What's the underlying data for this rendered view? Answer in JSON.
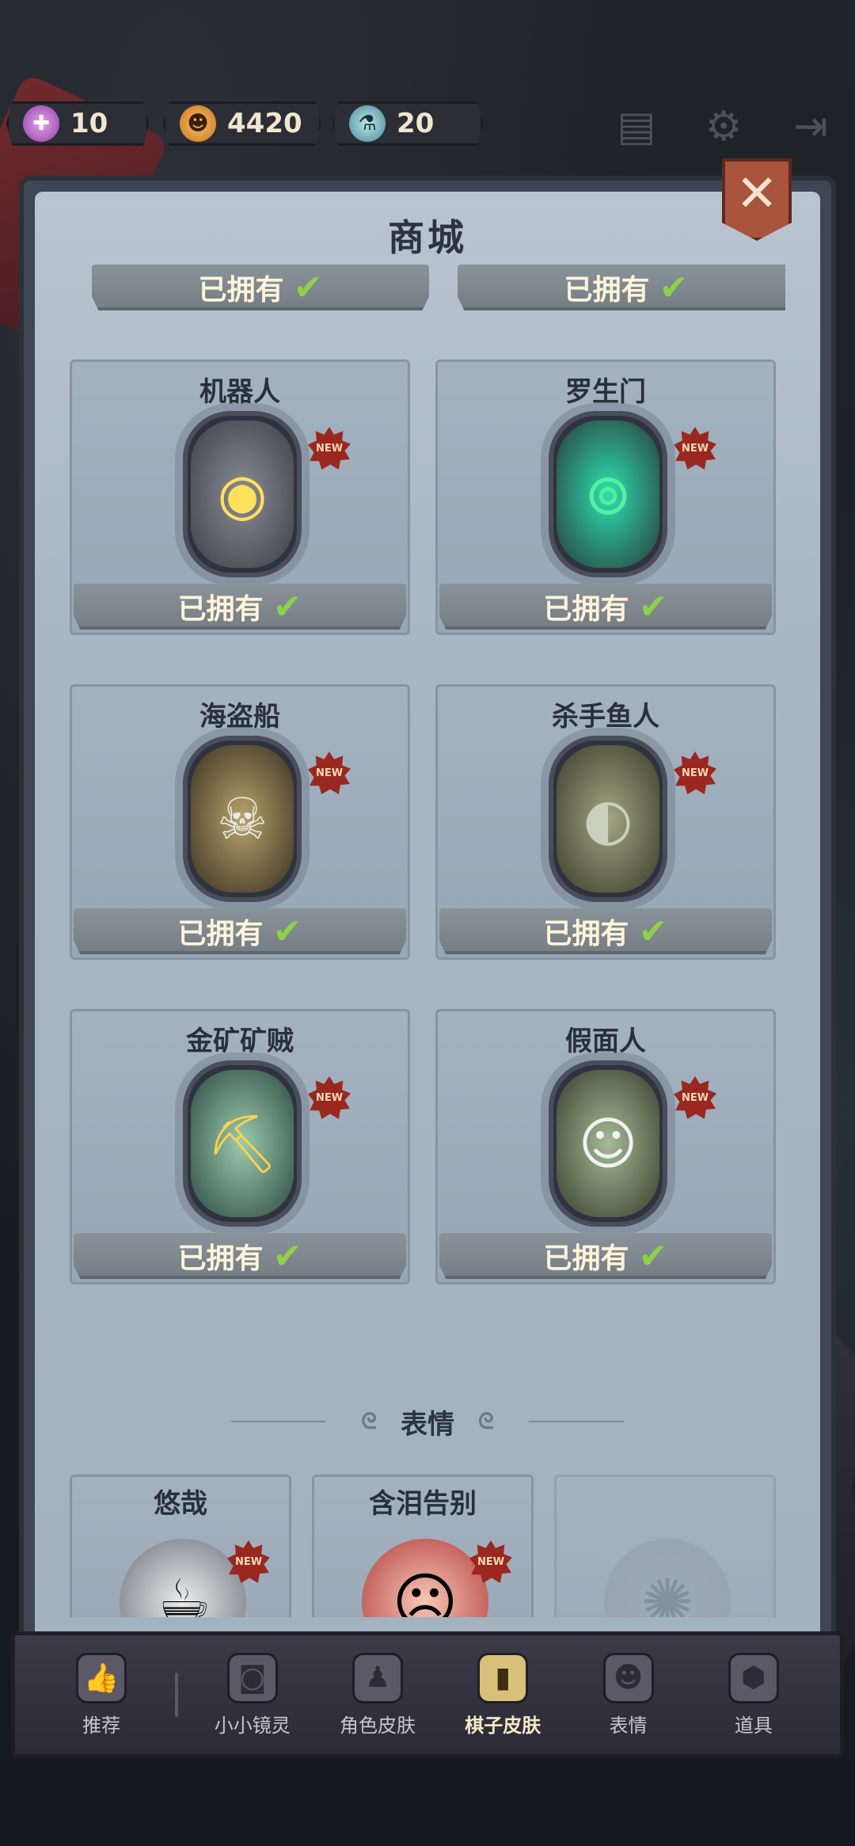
{
  "resources": {
    "candy": {
      "value": "10",
      "icon": "candy-icon"
    },
    "pumpkin": {
      "value": "4420",
      "icon": "pumpkin-icon"
    },
    "potion": {
      "value": "20",
      "icon": "potion-icon"
    }
  },
  "top_icons": [
    "book-icon",
    "gear-icon",
    "exit-icon"
  ],
  "shop": {
    "title": "商城",
    "owned_label": "已拥有",
    "items": [
      {
        "name": "机器人",
        "badge": "NEW"
      },
      {
        "name": "罗生门",
        "badge": "NEW"
      },
      {
        "name": "海盗船",
        "badge": "NEW"
      },
      {
        "name": "杀手鱼人",
        "badge": "NEW"
      },
      {
        "name": "金矿矿贼",
        "badge": "NEW"
      },
      {
        "name": "假面人",
        "badge": "NEW"
      }
    ],
    "emote_section": "表情",
    "emotes": [
      {
        "name": "悠哉",
        "badge": "NEW"
      },
      {
        "name": "含泪告别",
        "badge": "NEW"
      }
    ]
  },
  "nav": [
    {
      "label": "推荐"
    },
    {
      "label": "小小镜灵"
    },
    {
      "label": "角色皮肤"
    },
    {
      "label": "棋子皮肤"
    },
    {
      "label": "表情"
    },
    {
      "label": "道具"
    }
  ],
  "colors": {
    "accent": "#d9c07a",
    "close": "#a9543c",
    "check": "#8ed04a",
    "badge": "#9a2820"
  }
}
